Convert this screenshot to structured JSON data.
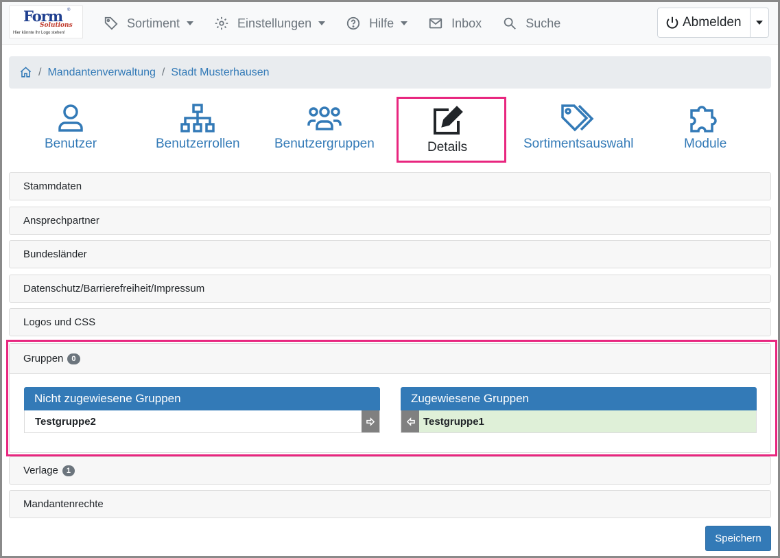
{
  "logo": {
    "line1": "Form",
    "line2": "Solutions",
    "line3": "Hier könnte Ihr Logo stehen!"
  },
  "nav": {
    "sortiment": "Sortiment",
    "einstellungen": "Einstellungen",
    "hilfe": "Hilfe",
    "inbox": "Inbox",
    "suche": "Suche",
    "logout": "Abmelden"
  },
  "breadcrumb": {
    "items": [
      "Mandantenverwaltung",
      "Stadt Musterhausen"
    ]
  },
  "tabs": {
    "benutzer": "Benutzer",
    "benutzerrollen": "Benutzerrollen",
    "benutzergruppen": "Benutzergruppen",
    "details": "Details",
    "sortimentsauswahl": "Sortimentsauswahl",
    "module": "Module"
  },
  "sections": {
    "stammdaten": "Stammdaten",
    "ansprechpartner": "Ansprechpartner",
    "bundeslaender": "Bundesländer",
    "datenschutz": "Datenschutz/Barrierefreiheit/Impressum",
    "logos": "Logos und CSS",
    "gruppen": "Gruppen",
    "gruppen_count": "0",
    "verlage": "Verlage",
    "verlage_count": "1",
    "mandantenrechte": "Mandantenrechte"
  },
  "groups": {
    "unassigned_title": "Nicht zugewiesene Gruppen",
    "unassigned": [
      "Testgruppe2"
    ],
    "assigned_title": "Zugewiesene Gruppen",
    "assigned": [
      "Testgruppe1"
    ]
  },
  "save_label": "Speichern",
  "colors": {
    "primary": "#337ab7",
    "highlight": "#e8267f",
    "assigned_bg": "#dff0d8"
  }
}
